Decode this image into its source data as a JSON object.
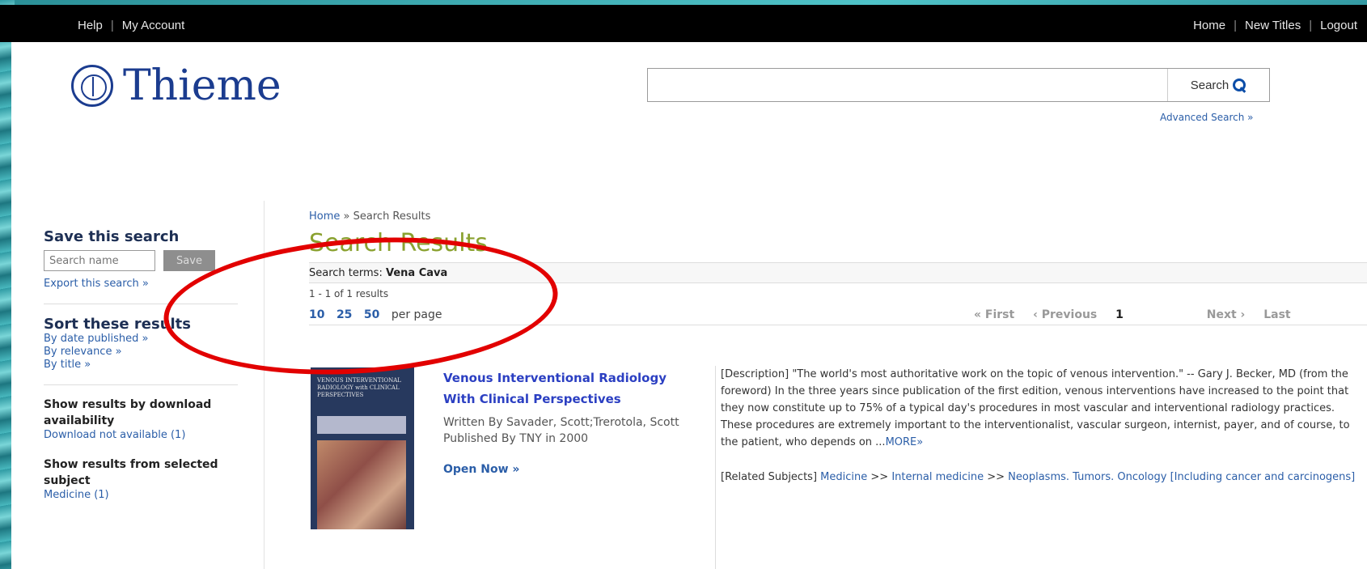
{
  "topbar": {
    "left": [
      "Help",
      "My Account"
    ],
    "right": [
      "Home",
      "New Titles",
      "Logout"
    ]
  },
  "brand": {
    "name": "Thieme"
  },
  "search": {
    "value": "",
    "button_label": "Search",
    "advanced": "Advanced Search »"
  },
  "sidebar": {
    "save_title": "Save this search",
    "save_placeholder": "Search name",
    "save_button": "Save",
    "export_link": "Export this search »",
    "sort_title": "Sort these results",
    "sort_options": [
      "By date published »",
      "By relevance »",
      "By title »"
    ],
    "download_title": "Show results by download availability",
    "download_link": "Download not available (1)",
    "subject_title": "Show results from selected subject",
    "subject_link": "Medicine (1)"
  },
  "main": {
    "breadcrumb_home": "Home",
    "breadcrumb_sep": "»",
    "breadcrumb_current": "Search Results",
    "title": "Search Results",
    "terms_label": "Search terms:",
    "terms_value": "Vena Cava",
    "count_text": "1 - 1 of 1 results",
    "per_page_options": [
      "10",
      "25",
      "50"
    ],
    "per_page_label": "per page",
    "pager": {
      "first": "« First",
      "previous": "‹ Previous",
      "current": "1",
      "next": "Next ›",
      "last": "Last"
    }
  },
  "result": {
    "cover_text": "VENOUS INTERVENTIONAL RADIOLOGY with CLINICAL PERSPECTIVES",
    "title": "Venous Interventional Radiology With Clinical Perspectives",
    "written_by": "Written By Savader, Scott;Trerotola, Scott",
    "published_by": "Published By TNY in 2000",
    "open_now": "Open Now »",
    "description": "[Description] \"The world's most authoritative work on the topic of venous intervention.\" -- Gary J. Becker, MD (from the foreword) In the three years since publication of the first edition, venous interventions have increased to the point that they now constitute up to 75% of a typical day's procedures in most vascular and interventional radiology practices. These procedures are extremely important to the interventionalist, vascular surgeon, internist, payer, and of course, to the patient, who depends on ...",
    "more": "MORE»",
    "related_label": "[Related Subjects]",
    "related_links": [
      "Medicine",
      "Internal medicine",
      "Neoplasms. Tumors. Oncology [Including cancer and carcinogens]"
    ],
    "related_sep": ">>"
  },
  "colors": {
    "topbar": "#000000",
    "brand": "#1b3c8f",
    "title_green": "#8aa12f",
    "link": "#2b5ea8",
    "annotation": "#e20000"
  }
}
